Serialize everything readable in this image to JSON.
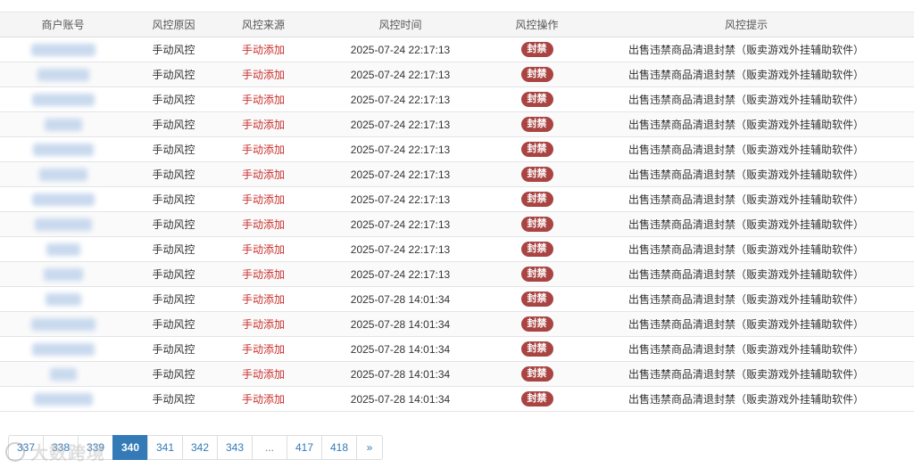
{
  "table": {
    "headers": [
      "商户账号",
      "风控原因",
      "风控来源",
      "风控时间",
      "风控操作",
      "风控提示"
    ],
    "rows": [
      {
        "reason": "手动风控",
        "source": "手动添加",
        "time": "2025-07-24 22:17:13",
        "action": "封禁",
        "tip": "出售违禁商品清退封禁（贩卖游戏外挂辅助软件）"
      },
      {
        "reason": "手动风控",
        "source": "手动添加",
        "time": "2025-07-24 22:17:13",
        "action": "封禁",
        "tip": "出售违禁商品清退封禁（贩卖游戏外挂辅助软件）"
      },
      {
        "reason": "手动风控",
        "source": "手动添加",
        "time": "2025-07-24 22:17:13",
        "action": "封禁",
        "tip": "出售违禁商品清退封禁（贩卖游戏外挂辅助软件）"
      },
      {
        "reason": "手动风控",
        "source": "手动添加",
        "time": "2025-07-24 22:17:13",
        "action": "封禁",
        "tip": "出售违禁商品清退封禁（贩卖游戏外挂辅助软件）"
      },
      {
        "reason": "手动风控",
        "source": "手动添加",
        "time": "2025-07-24 22:17:13",
        "action": "封禁",
        "tip": "出售违禁商品清退封禁（贩卖游戏外挂辅助软件）"
      },
      {
        "reason": "手动风控",
        "source": "手动添加",
        "time": "2025-07-24 22:17:13",
        "action": "封禁",
        "tip": "出售违禁商品清退封禁（贩卖游戏外挂辅助软件）"
      },
      {
        "reason": "手动风控",
        "source": "手动添加",
        "time": "2025-07-24 22:17:13",
        "action": "封禁",
        "tip": "出售违禁商品清退封禁（贩卖游戏外挂辅助软件）"
      },
      {
        "reason": "手动风控",
        "source": "手动添加",
        "time": "2025-07-24 22:17:13",
        "action": "封禁",
        "tip": "出售违禁商品清退封禁（贩卖游戏外挂辅助软件）"
      },
      {
        "reason": "手动风控",
        "source": "手动添加",
        "time": "2025-07-24 22:17:13",
        "action": "封禁",
        "tip": "出售违禁商品清退封禁（贩卖游戏外挂辅助软件）"
      },
      {
        "reason": "手动风控",
        "source": "手动添加",
        "time": "2025-07-24 22:17:13",
        "action": "封禁",
        "tip": "出售违禁商品清退封禁（贩卖游戏外挂辅助软件）"
      },
      {
        "reason": "手动风控",
        "source": "手动添加",
        "time": "2025-07-28 14:01:34",
        "action": "封禁",
        "tip": "出售违禁商品清退封禁（贩卖游戏外挂辅助软件）"
      },
      {
        "reason": "手动风控",
        "source": "手动添加",
        "time": "2025-07-28 14:01:34",
        "action": "封禁",
        "tip": "出售违禁商品清退封禁（贩卖游戏外挂辅助软件）"
      },
      {
        "reason": "手动风控",
        "source": "手动添加",
        "time": "2025-07-28 14:01:34",
        "action": "封禁",
        "tip": "出售违禁商品清退封禁（贩卖游戏外挂辅助软件）"
      },
      {
        "reason": "手动风控",
        "source": "手动添加",
        "time": "2025-07-28 14:01:34",
        "action": "封禁",
        "tip": "出售违禁商品清退封禁（贩卖游戏外挂辅助软件）"
      },
      {
        "reason": "手动风控",
        "source": "手动添加",
        "time": "2025-07-28 14:01:34",
        "action": "封禁",
        "tip": "出售违禁商品清退封禁（贩卖游戏外挂辅助软件）"
      }
    ]
  },
  "pagination": {
    "pages": [
      "337",
      "338",
      "339",
      "340",
      "341",
      "342",
      "343",
      "...",
      "417",
      "418",
      "»"
    ],
    "active": "340"
  },
  "watermark": {
    "text": "大数跨境"
  },
  "colors": {
    "accent": "#337ab7",
    "danger": "#a94442",
    "source_text": "#c9302c"
  }
}
